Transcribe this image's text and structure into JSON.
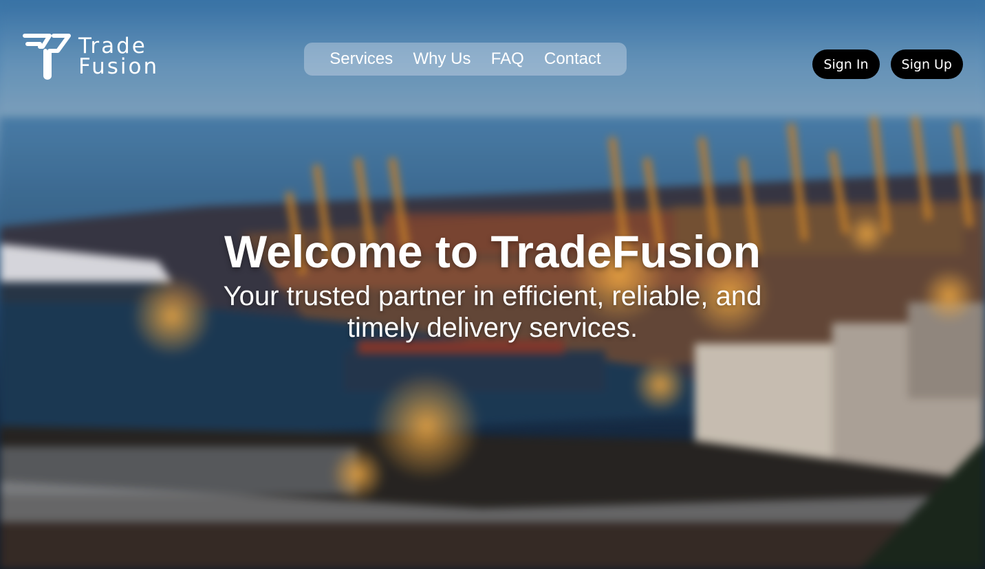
{
  "brand": {
    "name_line1": "Trade",
    "name_line2": "Fusion",
    "logo_icon": "tradefusion-logo-icon"
  },
  "nav": {
    "items": [
      {
        "label": "Services"
      },
      {
        "label": "Why Us"
      },
      {
        "label": "FAQ"
      },
      {
        "label": "Contact"
      }
    ]
  },
  "auth": {
    "sign_in_label": "Sign In",
    "sign_up_label": "Sign Up"
  },
  "hero": {
    "headline": "Welcome to TradeFusion",
    "tagline": "Your trusted partner in efficient, reliable, and timely delivery services.",
    "background": "blurred port with cranes and container ships at dusk"
  },
  "colors": {
    "text": "#ffffff",
    "button_bg": "#000000",
    "nav_bg": "rgba(220,230,240,0.38)"
  }
}
